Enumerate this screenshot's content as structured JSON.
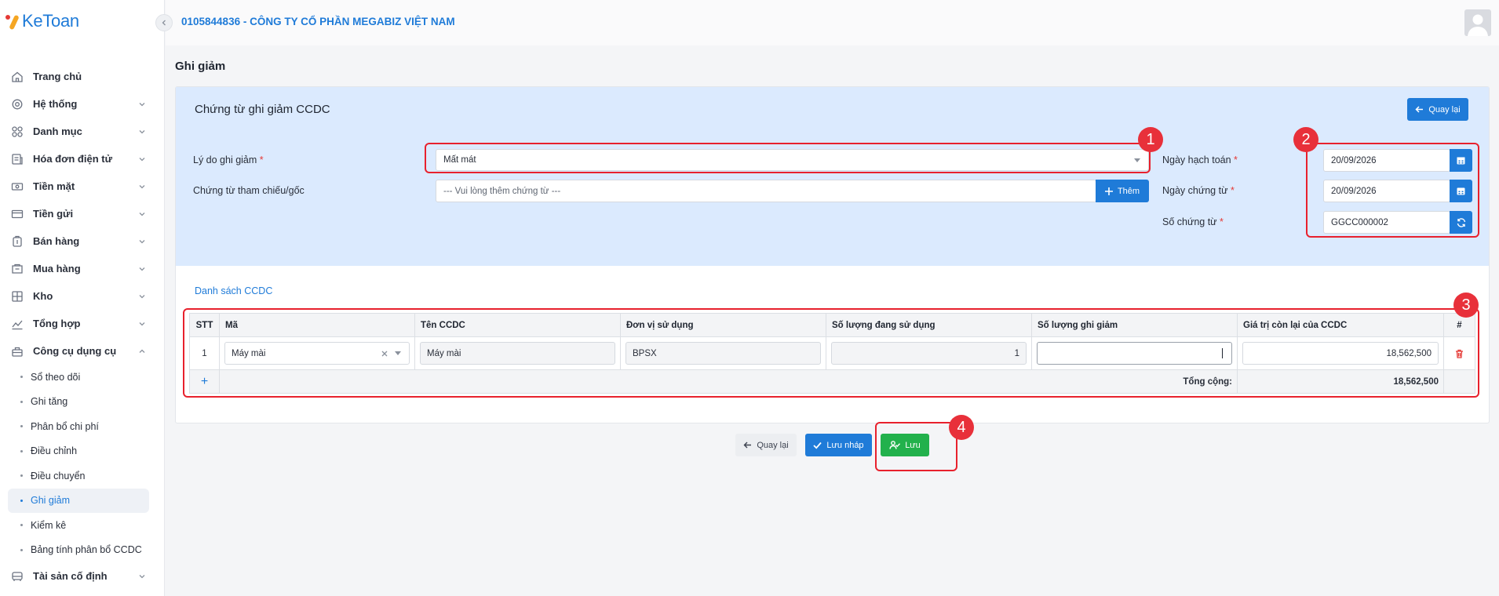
{
  "app": {
    "logo_text": "KeToan",
    "company": "0105844836 - CÔNG TY CỔ PHẦN MEGABIZ VIỆT NAM"
  },
  "sidebar": {
    "items": [
      {
        "label": "Trang chủ",
        "icon": "home-icon"
      },
      {
        "label": "Hệ thống",
        "icon": "gear-icon"
      },
      {
        "label": "Danh mục",
        "icon": "grid-icon"
      },
      {
        "label": "Hóa đơn điện tử",
        "icon": "invoice-icon"
      },
      {
        "label": "Tiền mặt",
        "icon": "cash-icon"
      },
      {
        "label": "Tiền gửi",
        "icon": "card-icon"
      },
      {
        "label": "Bán hàng",
        "icon": "sales-icon"
      },
      {
        "label": "Mua hàng",
        "icon": "purchase-icon"
      },
      {
        "label": "Kho",
        "icon": "warehouse-icon"
      },
      {
        "label": "Tổng hợp",
        "icon": "chart-icon"
      },
      {
        "label": "Công cụ dụng cụ",
        "icon": "tools-icon"
      }
    ],
    "sub_items": [
      {
        "label": "Sổ theo dõi"
      },
      {
        "label": "Ghi tăng"
      },
      {
        "label": "Phân bổ chi phí"
      },
      {
        "label": "Điều chỉnh"
      },
      {
        "label": "Điều chuyển"
      },
      {
        "label": "Ghi giảm",
        "active": true
      },
      {
        "label": "Kiểm kê"
      },
      {
        "label": "Bảng tính phân bổ CCDC"
      }
    ],
    "after": [
      {
        "label": "Tài sản cố định",
        "icon": "vehicle-icon"
      }
    ]
  },
  "page": {
    "title": "Ghi giảm"
  },
  "form": {
    "card_title": "Chứng từ ghi giảm CCDC",
    "back_top_label": "Quay lại",
    "reason_label": "Lý do ghi giảm",
    "reason_value": "Mất mát",
    "ref_label": "Chứng từ tham chiếu/gốc",
    "ref_placeholder": "--- Vui lòng thêm chứng từ ---",
    "add_label": "Thêm",
    "posting_date_label": "Ngày hạch toán",
    "posting_date": "20/09/2026",
    "doc_date_label": "Ngày chứng từ",
    "doc_date": "20/09/2026",
    "doc_no_label": "Số chứng từ",
    "doc_no": "GGCC000002",
    "required_mark": "*"
  },
  "table": {
    "section_title": "Danh sách CCDC",
    "headers": [
      "STT",
      "Mã",
      "Tên CCDC",
      "Đơn vị sử dụng",
      "Số lượng đang sử dụng",
      "Số lượng ghi giảm",
      "Giá trị còn lại của CCDC",
      "#"
    ],
    "rows": [
      {
        "stt": "1",
        "code": "Máy mài",
        "name": "Máy mài",
        "unit": "BPSX",
        "qty_in_use": "1",
        "qty_decrease": "",
        "remaining_value": "18,562,500"
      }
    ],
    "add_row": "+",
    "total_label": "Tổng cộng:",
    "total_value": "18,562,500"
  },
  "footer": {
    "back_label": "Quay lại",
    "draft_label": "Lưu nháp",
    "save_label": "Lưu"
  },
  "annotations": [
    "1",
    "2",
    "3",
    "4"
  ],
  "colors": {
    "accent": "#1f7bd8",
    "success": "#22b14c",
    "annotation": "#e8212d",
    "panel": "#dbeafe"
  }
}
